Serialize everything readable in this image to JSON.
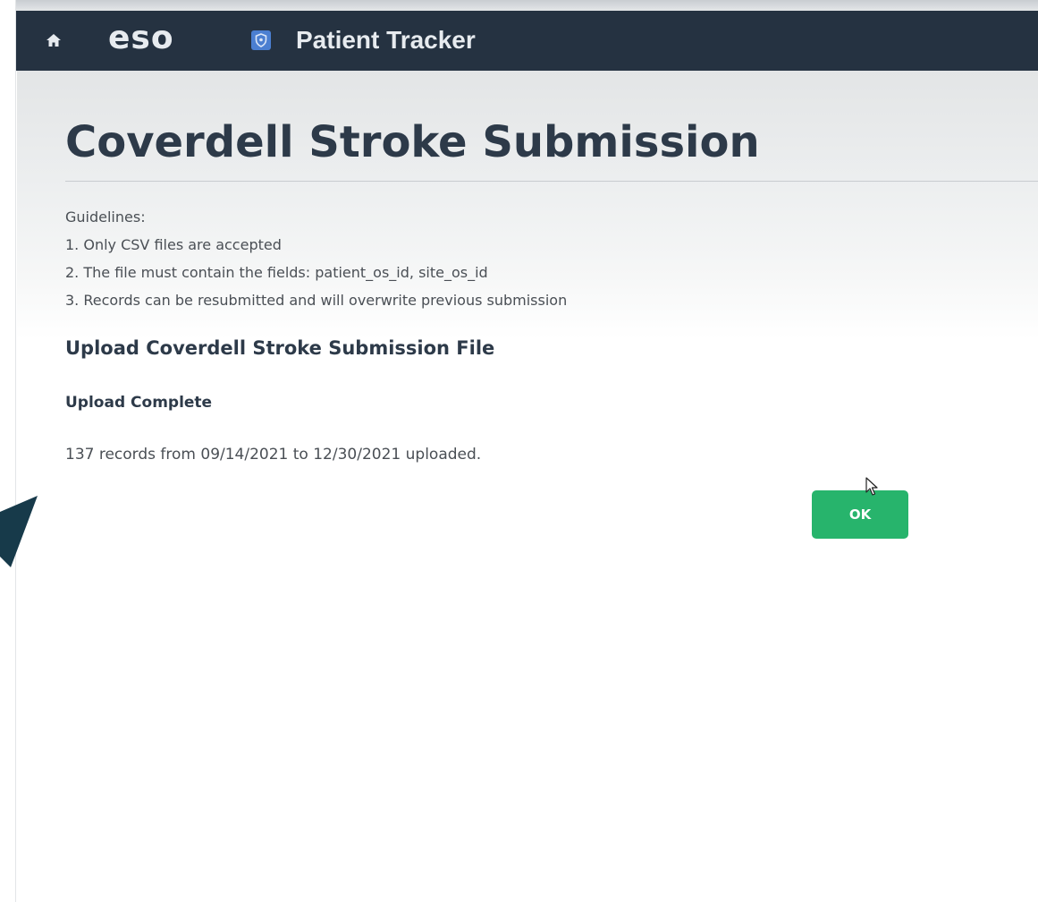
{
  "nav": {
    "home_icon": "home-icon",
    "logo_text": "eso",
    "app_icon": "shield-badge-icon",
    "app_title": "Patient Tracker"
  },
  "page": {
    "title": "Coverdell Stroke Submission"
  },
  "guidelines": {
    "heading": "Guidelines:",
    "items": [
      "1. Only CSV files are accepted",
      "2. The file must contain the fields: patient_os_id, site_os_id",
      "3. Records can be resubmitted and will overwrite previous submission"
    ]
  },
  "upload": {
    "heading": "Upload Coverdell Stroke Submission File",
    "status": "Upload Complete",
    "result": "137 records from 09/14/2021 to 12/30/2021 uploaded.",
    "ok_label": "OK"
  },
  "colors": {
    "nav_bg": "#253241",
    "heading": "#2d3a49",
    "body_text": "#4a4f55",
    "ok_button": "#27b46c",
    "app_badge": "#4b7fd1",
    "overlay": "#173a4a"
  }
}
